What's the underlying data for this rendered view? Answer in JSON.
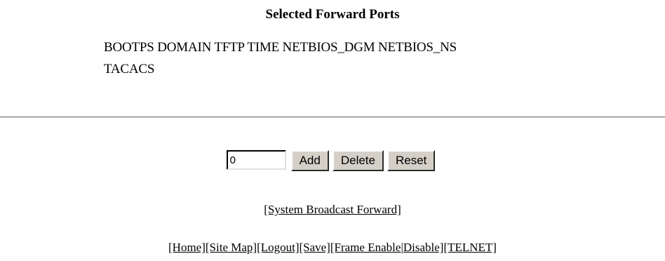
{
  "page": {
    "title": "Selected Forward Ports",
    "ports_line1": "BOOTPS DOMAIN TFTP TIME NETBIOS_DGM NETBIOS_NS",
    "ports_line2": "TACACS"
  },
  "form": {
    "port_value": "0",
    "add_label": "Add",
    "delete_label": "Delete",
    "reset_label": "Reset"
  },
  "links": {
    "system_broadcast_forward": "[System Broadcast Forward]"
  },
  "footer": {
    "items": [
      "[Home]",
      "[Site Map]",
      "[Logout]",
      "[Save]",
      "[Frame Enable",
      "|",
      "Disable]",
      "[TELNET]"
    ]
  }
}
